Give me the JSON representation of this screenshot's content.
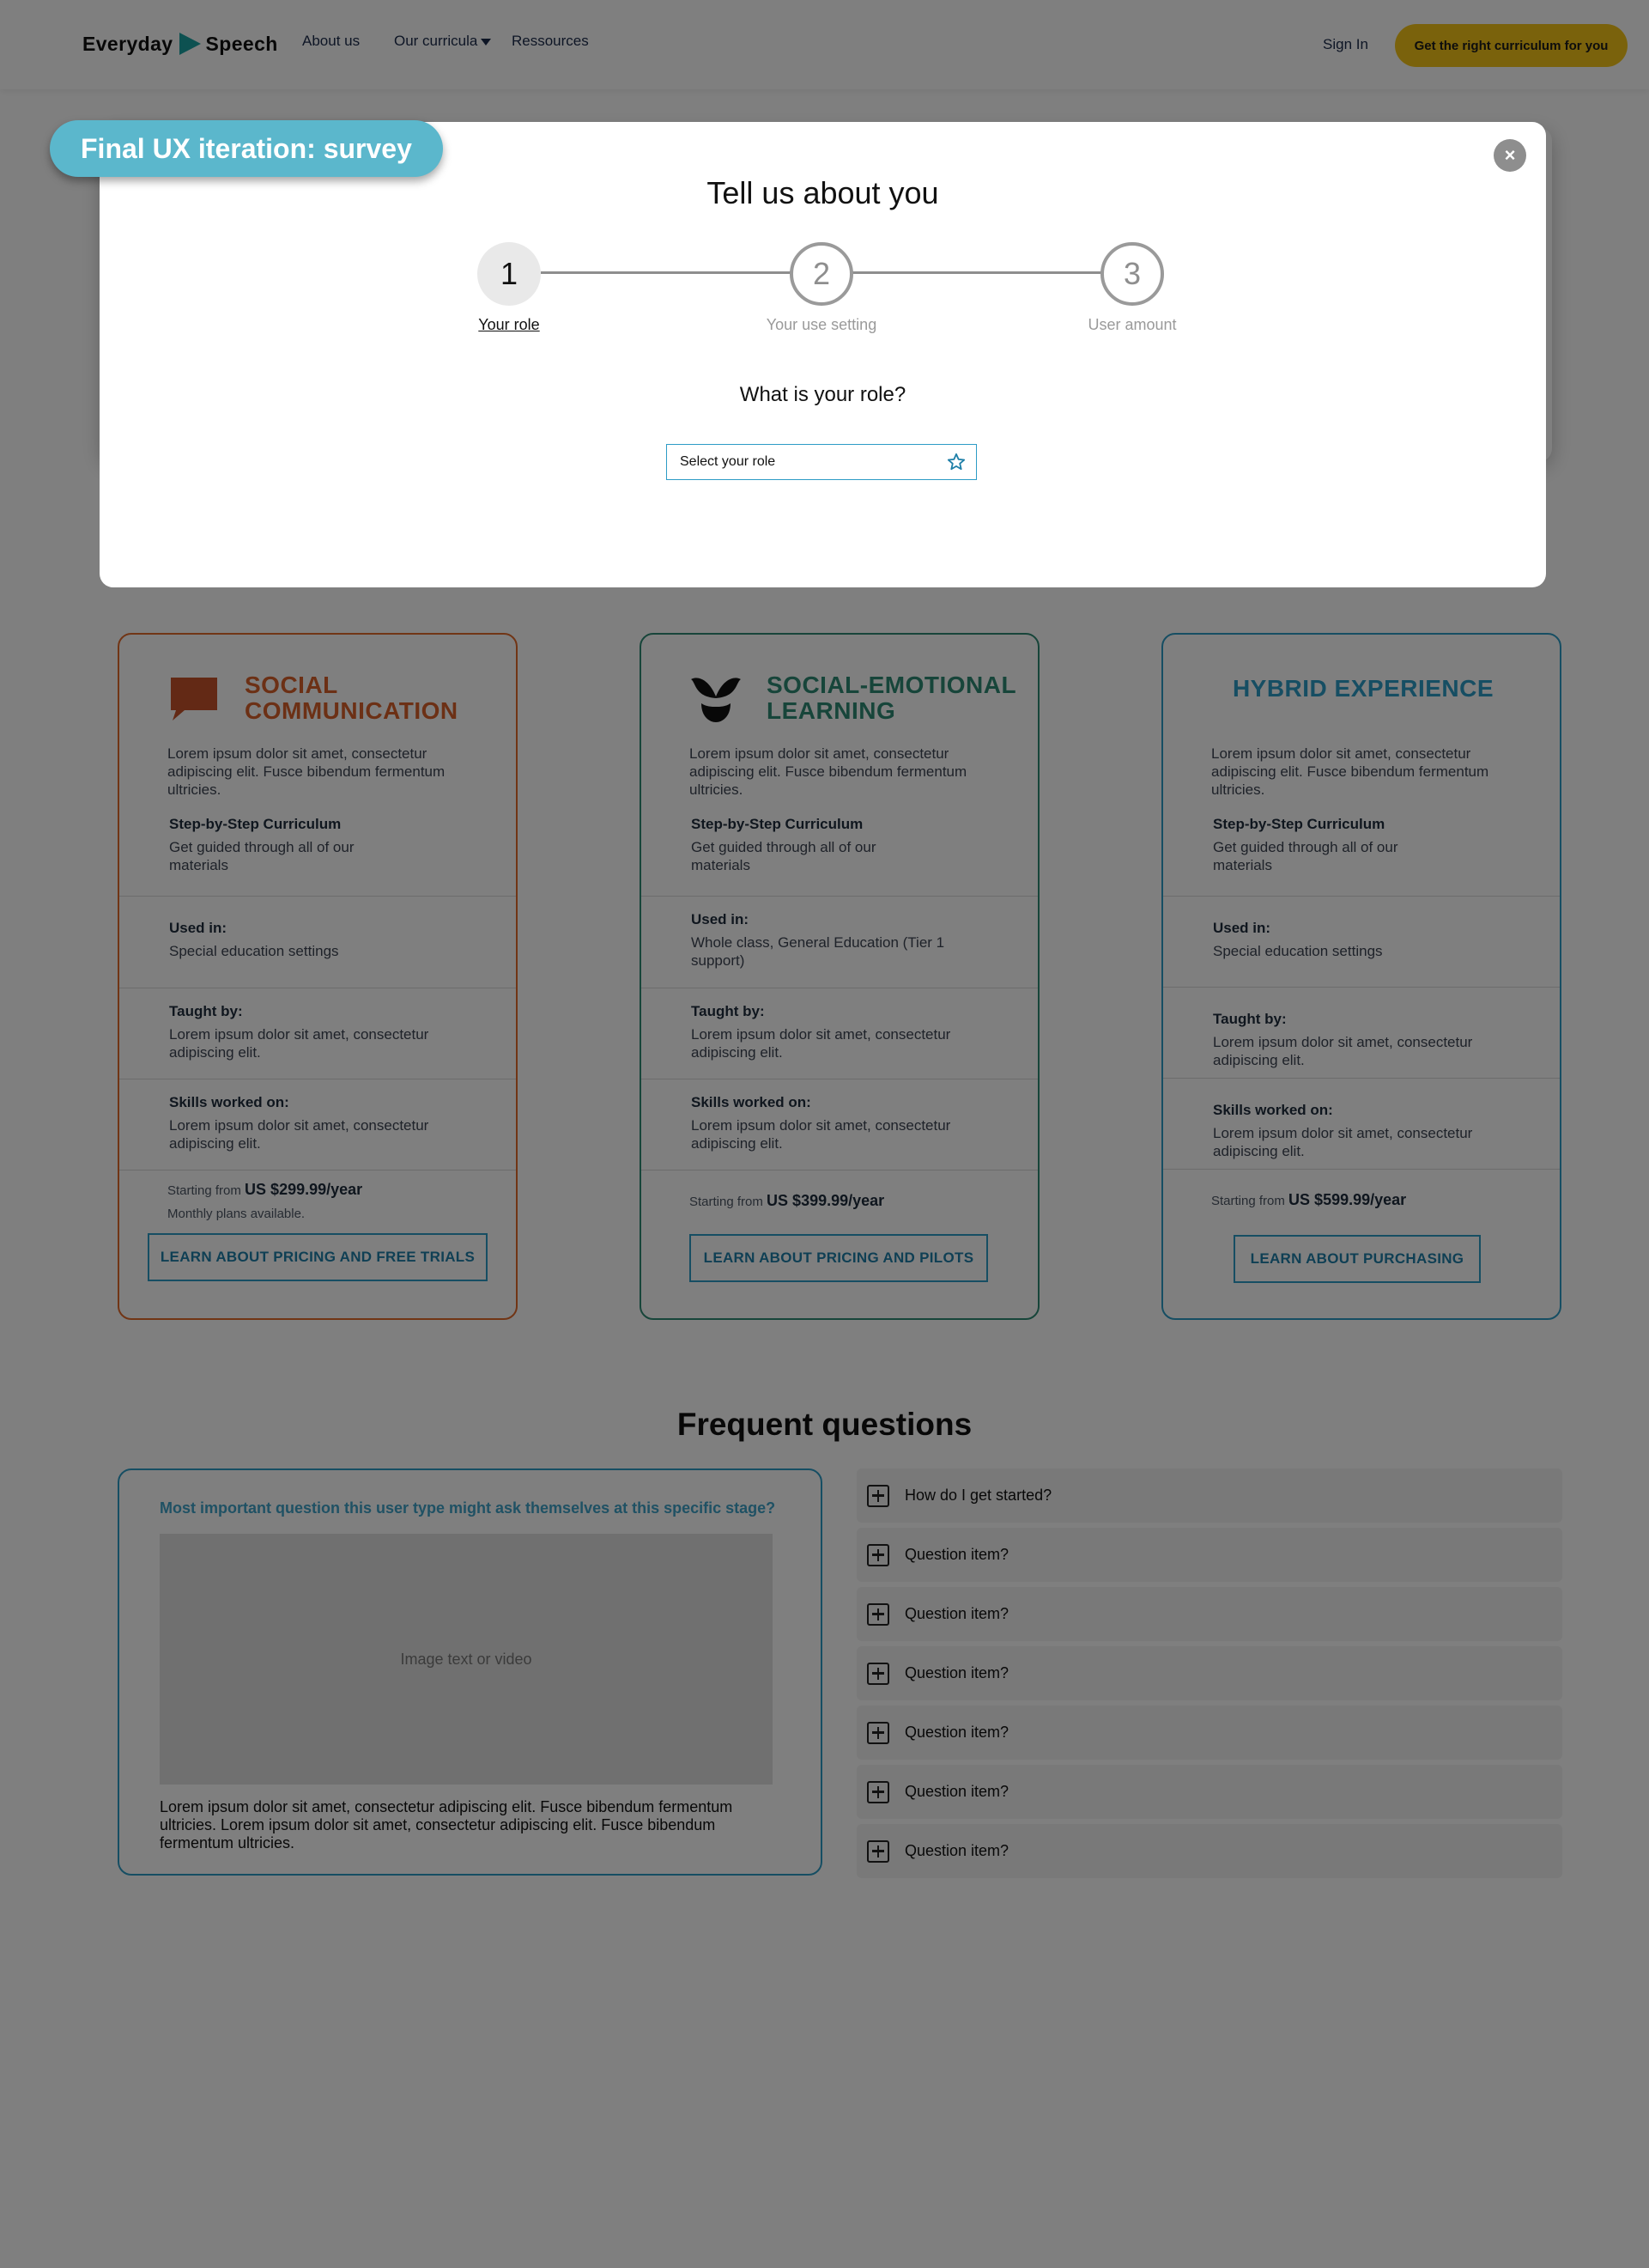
{
  "header": {
    "logo_left": "Everyday",
    "logo_right": "Speech",
    "nav": [
      "About us",
      "Our curricula",
      "Ressources"
    ],
    "sign_in": "Sign In",
    "cta": "Get the right curriculum for you"
  },
  "overlay_badge": "Final UX iteration: survey",
  "modal": {
    "title": "Tell us about you",
    "steps": [
      {
        "number": "1",
        "label": "Your role",
        "state": "active"
      },
      {
        "number": "2",
        "label": "Your use setting",
        "state": "upcoming"
      },
      {
        "number": "3",
        "label": "User amount",
        "state": "upcoming"
      }
    ],
    "question": "What is your role?",
    "select_value": "Select your role",
    "close_icon": "close-icon",
    "select_icon": "star-icon"
  },
  "cards": [
    {
      "title": "SOCIAL COMMUNICATION",
      "title_lines": [
        "SOCIAL",
        "COMMUNICATION"
      ],
      "icon": "speech-bubble-icon",
      "color": "#e36a2b",
      "intro": "Lorem ipsum dolor sit amet, consectetur adipiscing elit. Fusce bibendum fermentum ultricies.",
      "features": [
        {
          "heading": "Step-by-Step Curriculum",
          "text": "Get guided through all of our materials"
        },
        {
          "heading": "Used in:",
          "text": "Special education settings"
        },
        {
          "heading": "Taught by:",
          "text": "Lorem ipsum dolor sit amet, consectetur adipiscing elit."
        },
        {
          "heading": "Skills worked on:",
          "text": "Lorem ipsum dolor sit amet, consectetur adipiscing elit."
        }
      ],
      "price_prefix": "Starting from",
      "price": "US $299.99/year",
      "price_note": "Monthly plans available.",
      "button": "LEARN ABOUT PRICING AND FREE TRIALS"
    },
    {
      "title": "SOCIAL-EMOTIONAL LEARNING",
      "title_lines": [
        "SOCIAL-EMOTIONAL",
        "LEARNING"
      ],
      "icon": "sprout-icon",
      "color": "#2e8b74",
      "intro": "Lorem ipsum dolor sit amet, consectetur adipiscing elit. Fusce bibendum fermentum ultricies.",
      "features": [
        {
          "heading": "Step-by-Step Curriculum",
          "text": "Get guided through all of our materials"
        },
        {
          "heading": "Used in:",
          "text": "Whole class, General Education (Tier 1 support)"
        },
        {
          "heading": "Taught by:",
          "text": "Lorem ipsum dolor sit amet, consectetur adipiscing elit."
        },
        {
          "heading": "Skills worked on:",
          "text": "Lorem ipsum dolor sit amet, consectetur adipiscing elit."
        }
      ],
      "price_prefix": "Starting from",
      "price": "US $399.99/year",
      "button": "LEARN ABOUT PRICING AND PILOTS"
    },
    {
      "title": "HYBRID EXPERIENCE",
      "color": "#2d9cc6",
      "intro": "Lorem ipsum dolor sit amet, consectetur adipiscing elit. Fusce bibendum fermentum ultricies.",
      "features": [
        {
          "heading": "Step-by-Step Curriculum",
          "text": "Get guided through all of our materials"
        },
        {
          "heading": "Used in:",
          "text": "Special education settings"
        },
        {
          "heading": "Taught by:",
          "text": "Lorem ipsum dolor sit amet, consectetur adipiscing elit."
        },
        {
          "heading": "Skills worked on:",
          "text": "Lorem ipsum dolor sit amet, consectetur adipiscing elit."
        }
      ],
      "price_prefix": "Starting from",
      "price": "US $599.99/year",
      "button": "LEARN ABOUT PURCHASING"
    }
  ],
  "faq": {
    "title": "Frequent questions",
    "featured_question": "Most important question this user type might ask themselves at this specific stage?",
    "media_placeholder": "Image text or video",
    "featured_answer": "Lorem ipsum dolor sit amet, consectetur adipiscing elit. Fusce bibendum fermentum ultricies. Lorem ipsum dolor sit amet, consectetur adipiscing elit. Fusce bibendum fermentum ultricies.",
    "items": [
      "How do I get started?",
      "Question item?",
      "Question item?",
      "Question item?",
      "Question item?",
      "Question item?",
      "Question item?"
    ],
    "item_icon": "plus-square-icon"
  }
}
